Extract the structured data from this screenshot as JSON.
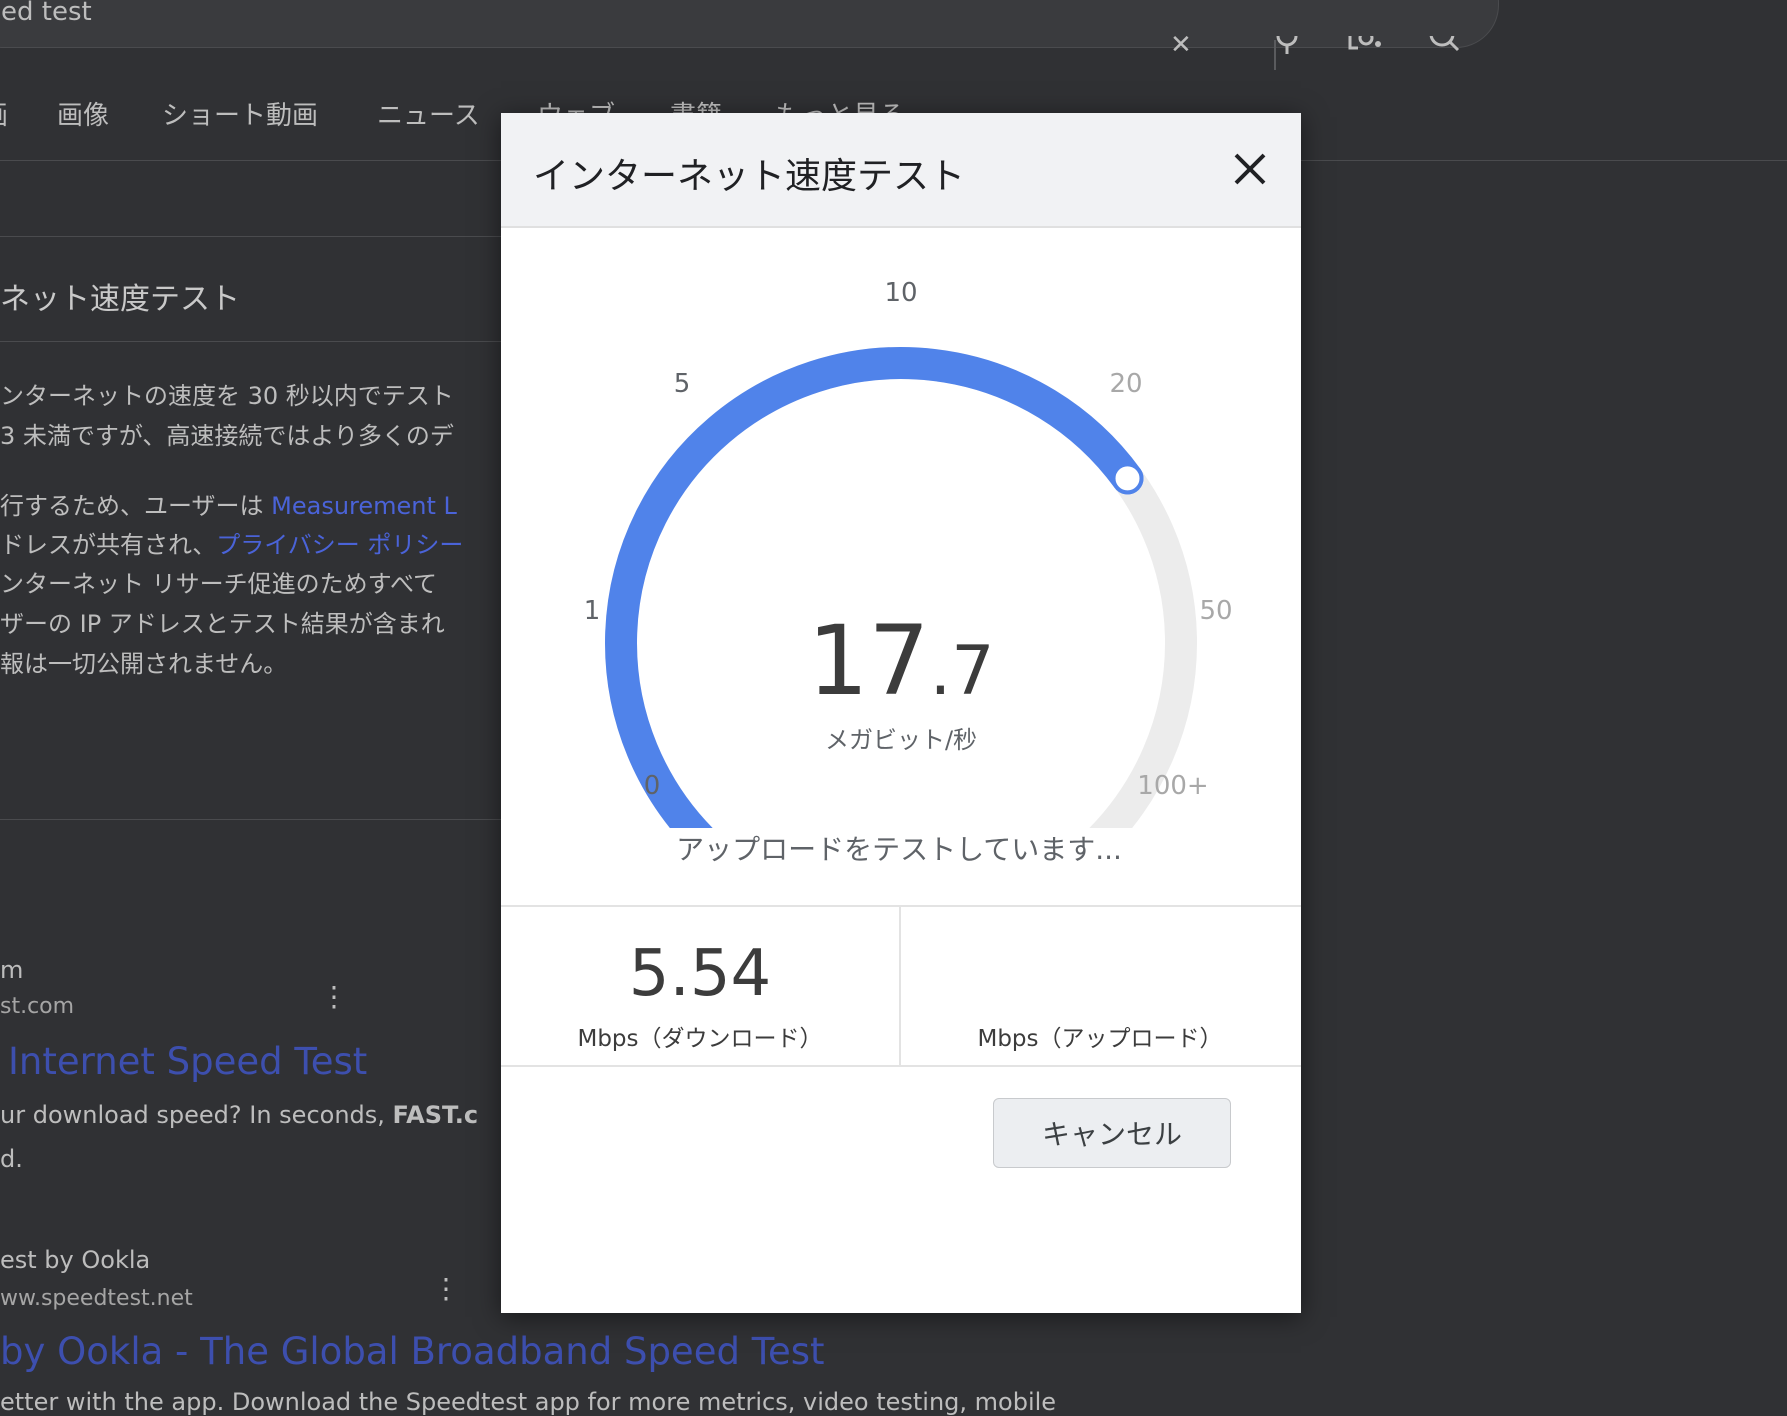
{
  "background": {
    "search_query": "ed test",
    "tabs": [
      "画",
      "画像",
      "ショート動画",
      "ニュース",
      "ウェブ",
      "書籍",
      "もっと見る"
    ],
    "section_title": "ネット速度テスト",
    "paragraph_lines": [
      "ンターネットの速度を 30 秒以内でテスト",
      "3 未満ですが、高速接続ではより多くのデ"
    ],
    "privacy_lines": {
      "l1_text": "行するため、ユーザーは ",
      "l1_link": "Measurement L",
      "l2_text": "ドレスが共有され、",
      "l2_link": "プライバシー ポリシー",
      "l3": "ンターネット リサーチ促進のためすべて",
      "l4": "ザーの IP アドレスとテスト結果が含まれ",
      "l5": "報は一切公開されません。"
    },
    "result1": {
      "site": "m",
      "url": "st.com",
      "title": "Internet Speed Test",
      "snippet_pre": "ur download speed? In seconds, ",
      "snippet_bold": "FAST.c",
      "snippet_line2": "d."
    },
    "result2": {
      "site": "est by Ookla",
      "url": "ww.speedtest.net",
      "title": "by Ookla - The Global Broadband Speed Test",
      "snippet": "etter with the app. Download the Speedtest app for more metrics, video testing, mobile"
    }
  },
  "modal": {
    "title": "インターネット速度テスト",
    "gauge": {
      "ticks": [
        "0",
        "1",
        "5",
        "10",
        "20",
        "50",
        "100+"
      ],
      "value_fraction": 0.7,
      "speed_integer": "17",
      "speed_decimal": ".7",
      "unit": "メガビット/秒"
    },
    "status": "アップロードをテストしています...",
    "download_value": "5.54",
    "download_label": "Mbps（ダウンロード）",
    "upload_value": "",
    "upload_label": "Mbps（アップロード）",
    "cancel_label": "キャンセル",
    "colors": {
      "arc_active": "#5083ea",
      "arc_track": "#ececec"
    }
  }
}
